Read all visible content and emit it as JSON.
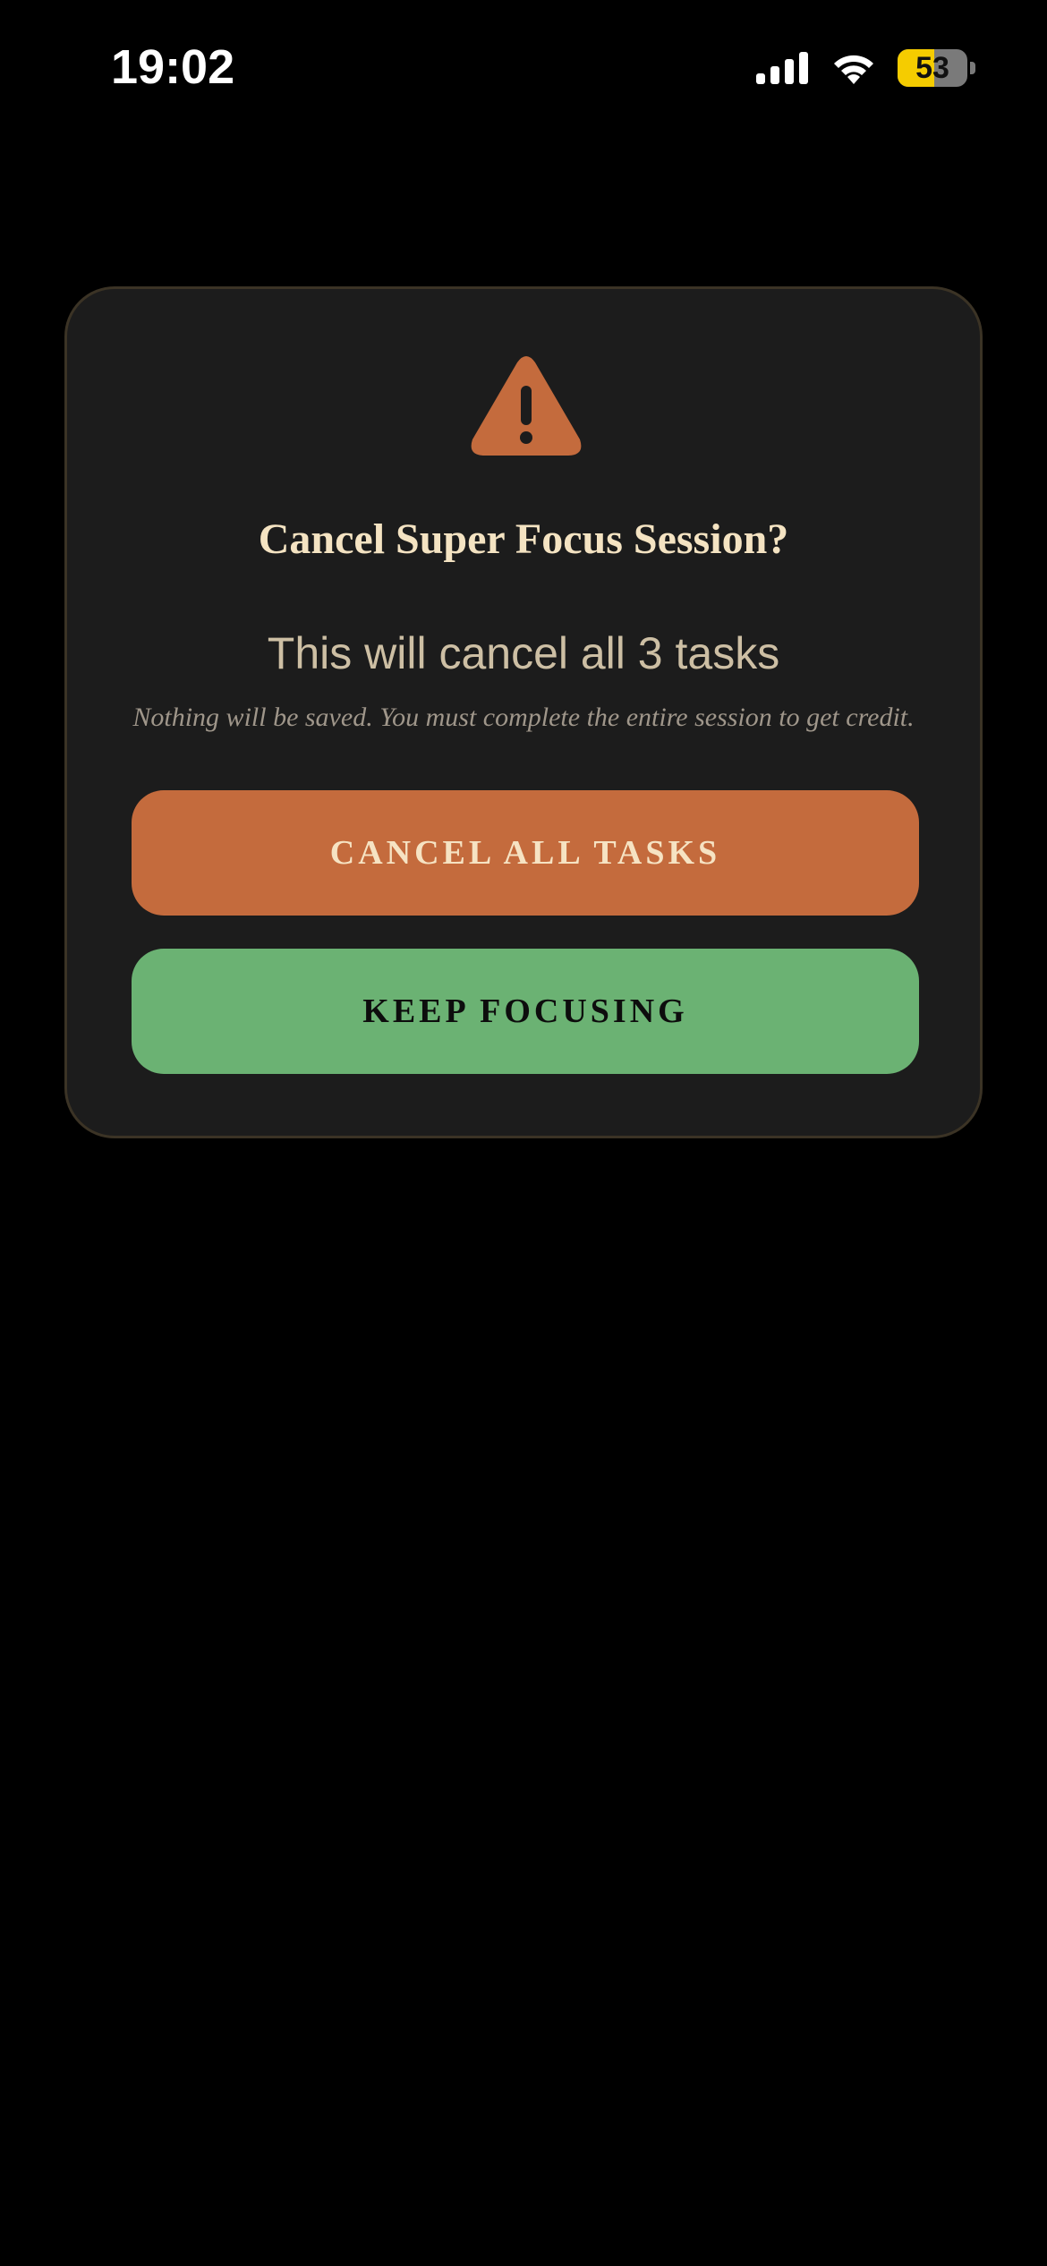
{
  "status_bar": {
    "time": "19:02",
    "battery_level": "53",
    "battery_fraction": 0.53,
    "icons": [
      "signal-icon",
      "wifi-icon",
      "battery-icon"
    ]
  },
  "dialog": {
    "icon": "warning-icon",
    "title": "Cancel Super Focus Session?",
    "subtitle": "This will cancel all 3 tasks",
    "note": "Nothing will be saved. You must complete the entire session to get credit.",
    "cancel_label": "CANCEL ALL TASKS",
    "keep_label": "KEEP FOCUSING"
  },
  "colors": {
    "background": "#000000",
    "card": "#1c1c1c",
    "card_border": "#3b3325",
    "accent_orange": "#c46b3d",
    "accent_green": "#6bb273",
    "title_text": "#f4e3c2",
    "battery_yellow": "#f5cc00"
  }
}
